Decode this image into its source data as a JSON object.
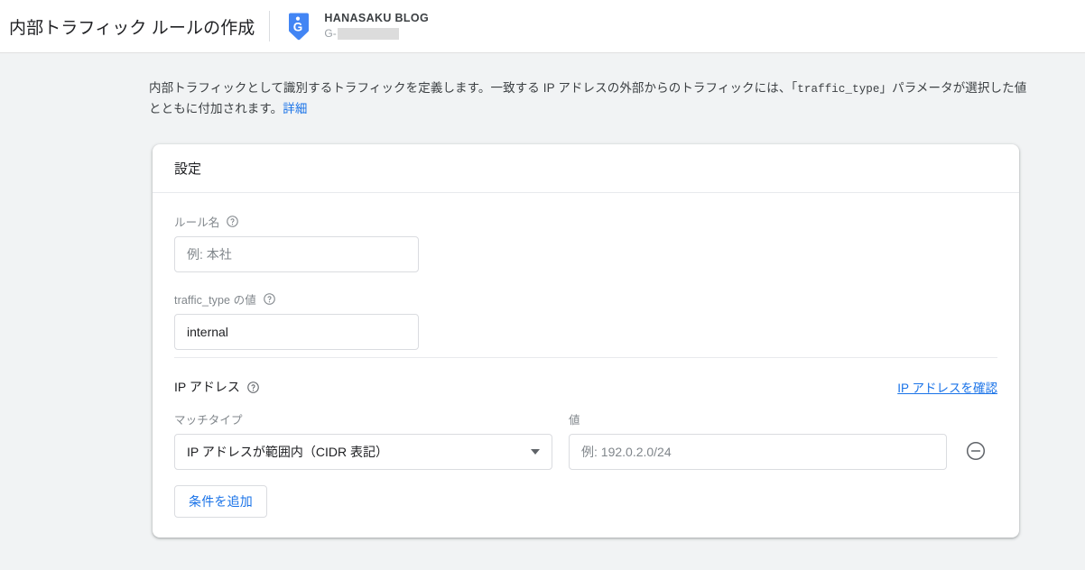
{
  "header": {
    "title": "内部トラフィック ルールの作成",
    "tag_icon": "google-analytics-tag-icon",
    "property_name": "HANASAKU BLOG",
    "property_id_prefix": "G-",
    "property_id_value": ""
  },
  "description": {
    "part1": "内部トラフィックとして識別するトラフィックを定義します。一致する IP アドレスの外部からのトラフィックには、「",
    "code": "traffic_type",
    "part2": "」パラメータが選択した値とともに付加されます。",
    "learn_more": "詳細"
  },
  "card": {
    "header_title": "設定",
    "rule_name": {
      "label": "ルール名",
      "help_icon": "help-outline-icon",
      "value": "",
      "placeholder": "例: 本社"
    },
    "traffic_type": {
      "label": "traffic_type の値",
      "help_icon": "help-outline-icon",
      "value": "internal",
      "placeholder": ""
    },
    "ip_section": {
      "title": "IP アドレス",
      "help_icon": "help-outline-icon",
      "check_ip_link": "IP アドレスを確認",
      "match_type_label": "マッチタイプ",
      "match_type_value": "IP アドレスが範囲内（CIDR 表記）",
      "match_type_caret": "caret-down-icon",
      "value_label": "値",
      "value": "",
      "value_placeholder": "例: 192.0.2.0/24",
      "remove_icon": "remove-circle-outline-icon",
      "add_condition_label": "条件を追加"
    }
  },
  "colors": {
    "accent": "#1a73e8",
    "page_background": "#f1f3f4",
    "card_background": "#ffffff",
    "border": "#dadce0",
    "text_primary": "#202124",
    "text_secondary": "#80868b"
  }
}
